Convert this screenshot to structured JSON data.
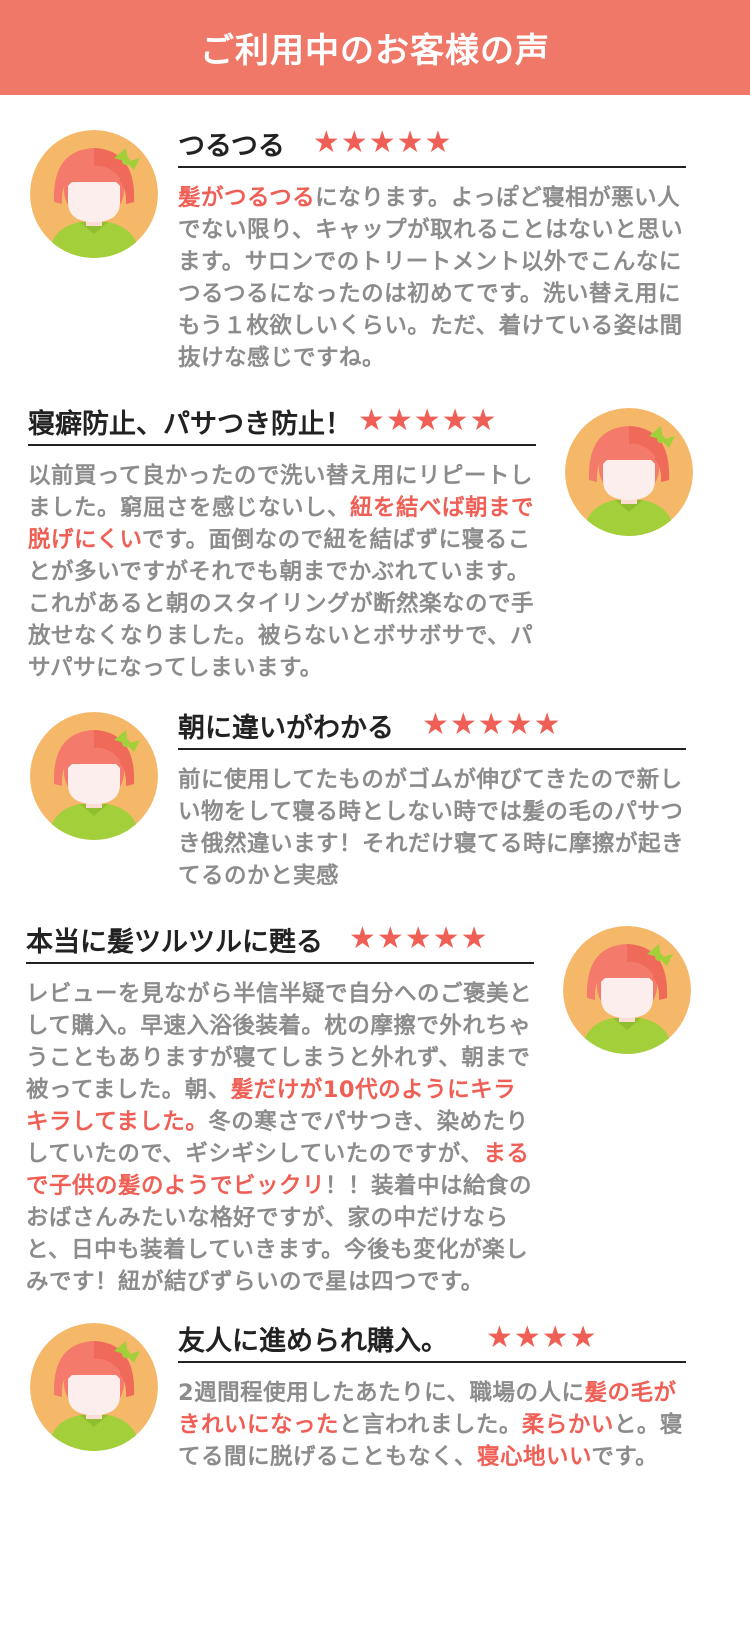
{
  "header": {
    "title": "ご利用中のお客様の声"
  },
  "reviews": [
    {
      "title": "つるつる",
      "stars": "★★★★★",
      "segments": [
        {
          "t": "髪がつるつる",
          "hl": true
        },
        {
          "t": "になります。よっぽど寝相が悪い人でない限り、キャップが取れることはないと思います。サロンでのトリートメント以外でこんなにつるつるになったのは初めてです。洗い替え用にもう１枚欲しいくらい。ただ、着けている姿は間抜けな感じですね。",
          "hl": false
        }
      ]
    },
    {
      "title": "寝癖防止、パサつき防止！",
      "stars": "★★★★★",
      "segments": [
        {
          "t": "以前買って良かったので洗い替え用にリピートしました。窮屈さを感じないし、",
          "hl": false
        },
        {
          "t": "紐を結べば朝まで脱げにくい",
          "hl": true
        },
        {
          "t": "です。面倒なので紐を結ばずに寝ることが多いですがそれでも朝までかぶれています。これがあると朝のスタイリングが断然楽なので手放せなくなりました。被らないとボサボサで、パサパサになってしまいます。",
          "hl": false
        }
      ]
    },
    {
      "title": "朝に違いがわかる",
      "stars": "★★★★★",
      "segments": [
        {
          "t": "前に使用してたものがゴムが伸びてきたので新しい物をして寝る時としない時では髪の毛のパサつき俄然違います！それだけ寝てる時に摩擦が起きてるのかと実感",
          "hl": false
        }
      ]
    },
    {
      "title": "本当に髪ツルツルに甦る",
      "stars": "★★★★★",
      "segments": [
        {
          "t": "レビューを見ながら半信半疑で自分へのご褒美として購入。早速入浴後装着。枕の摩擦で外れちゃうこともありますが寝てしまうと外れず、朝まで被ってました。朝、",
          "hl": false
        },
        {
          "t": "髪だけが10代のようにキラキラしてました。",
          "hl": true
        },
        {
          "t": "冬の寒さでパサつき、染めたりしていたので、ギシギシしていたのですが、",
          "hl": false
        },
        {
          "t": "まるで子供の髪のようでビックリ",
          "hl": true
        },
        {
          "t": "！！装着中は給食のおばさんみたいな格好ですが、家の中だけならと、日中も装着していきます。今後も変化が楽しみです！紐が結びずらいので星は四つです。",
          "hl": false
        }
      ]
    },
    {
      "title": "友人に進められ購入。",
      "stars": "★★★★",
      "segments": [
        {
          "t": "2週間程使用したあたりに、職場の人に",
          "hl": false
        },
        {
          "t": "髪の毛がきれいになった",
          "hl": true
        },
        {
          "t": "と言われました。",
          "hl": false
        },
        {
          "t": "柔らかい",
          "hl": true
        },
        {
          "t": "と。寝てる間に脱げることもなく、",
          "hl": false
        },
        {
          "t": "寝心地いい",
          "hl": true
        },
        {
          "t": "です。",
          "hl": false
        }
      ]
    }
  ],
  "colors": {
    "header": "#ef7868",
    "highlight": "#ef5f55",
    "avatar_bg": "#f5b869",
    "hair": "#f47a6c",
    "bow": "#a2cf3a",
    "shirt": "#a2cf3a"
  }
}
